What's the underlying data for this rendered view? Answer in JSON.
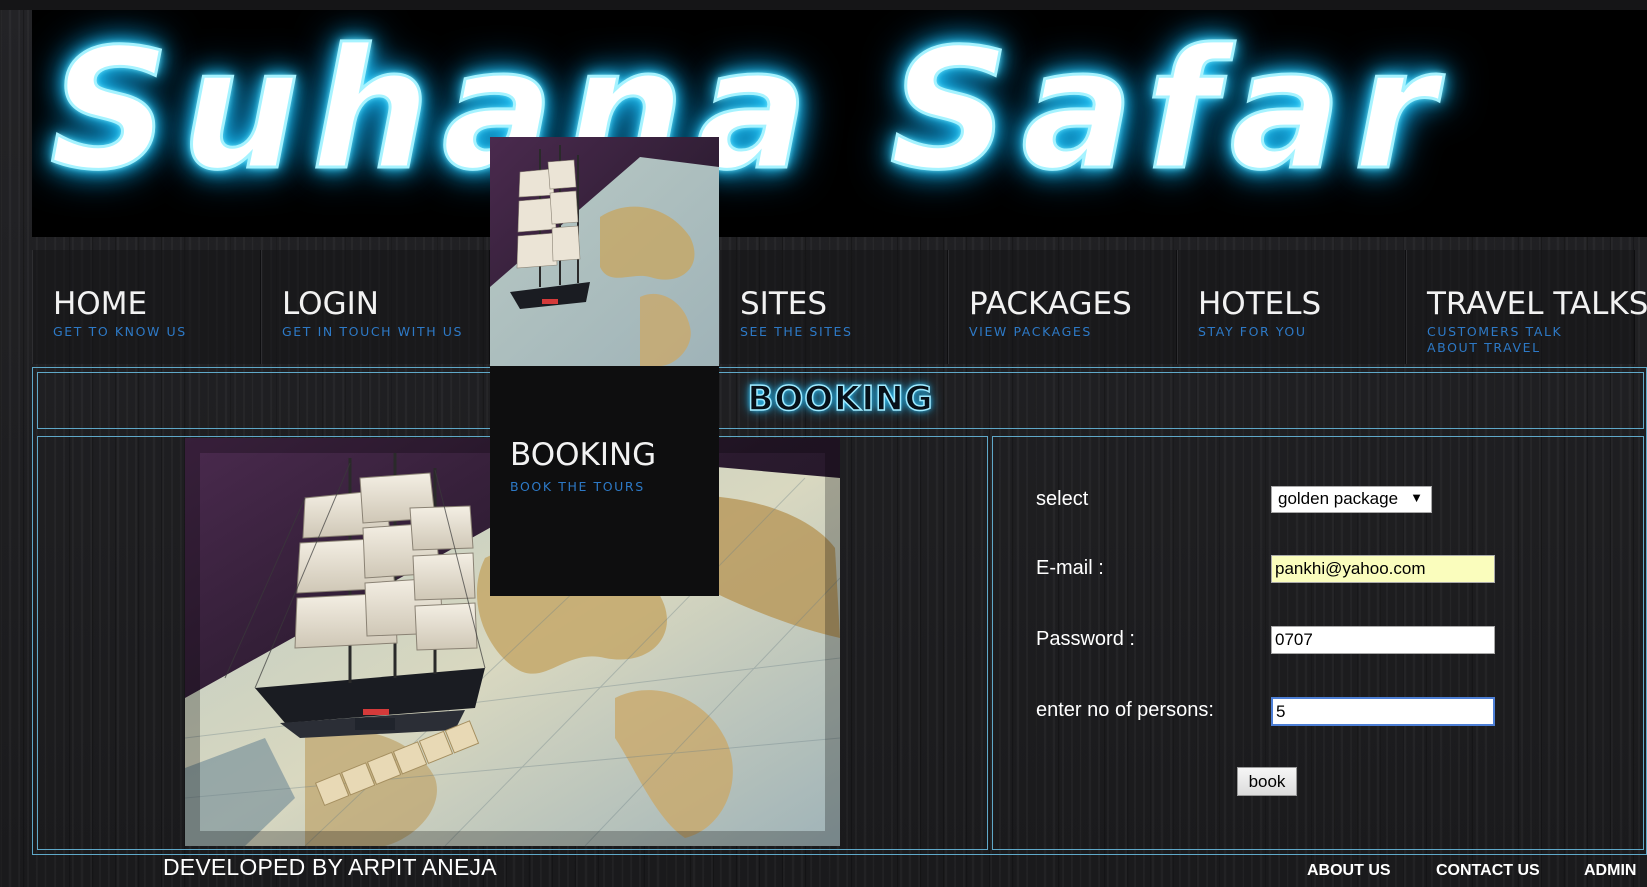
{
  "banner": {
    "title": "Suhana Safar"
  },
  "nav": {
    "items": [
      {
        "label": "HOME",
        "sub": "GET TO KNOW US"
      },
      {
        "label": "LOGIN",
        "sub": "GET IN TOUCH WITH US"
      },
      {
        "label": "BOOKING",
        "sub": "BOOK THE TOURS"
      },
      {
        "label": "SITES",
        "sub": "SEE THE SITES"
      },
      {
        "label": "PACKAGES",
        "sub": "VIEW PACKAGES"
      },
      {
        "label": "HOTELS",
        "sub": "STAY FOR YOU"
      },
      {
        "label": "TRAVEL TALKS",
        "sub": "CUSTOMERS TALK ABOUT TRAVEL"
      }
    ]
  },
  "main": {
    "heading": "BOOKING",
    "form": {
      "select_label": "select",
      "select_value": "golden package",
      "email_label": "E-mail :",
      "email_value": "pankhi@yahoo.com",
      "password_label": "Password :",
      "password_value": "0707",
      "persons_label": "enter no of persons:",
      "persons_value": "5",
      "submit_label": "book"
    }
  },
  "footer": {
    "developer": "DEVELOPED BY ARPIT ANEJA",
    "links": [
      "ABOUT US",
      "CONTACT US",
      "ADMIN"
    ]
  },
  "colors": {
    "glow": "#2ccfff",
    "subtext": "#2d79c6",
    "frame_border": "#5fa8c8",
    "email_autofill_bg": "#fafdbd",
    "focus_border": "#4d7fd6"
  },
  "icons": [
    "dropdown-arrow-icon"
  ]
}
